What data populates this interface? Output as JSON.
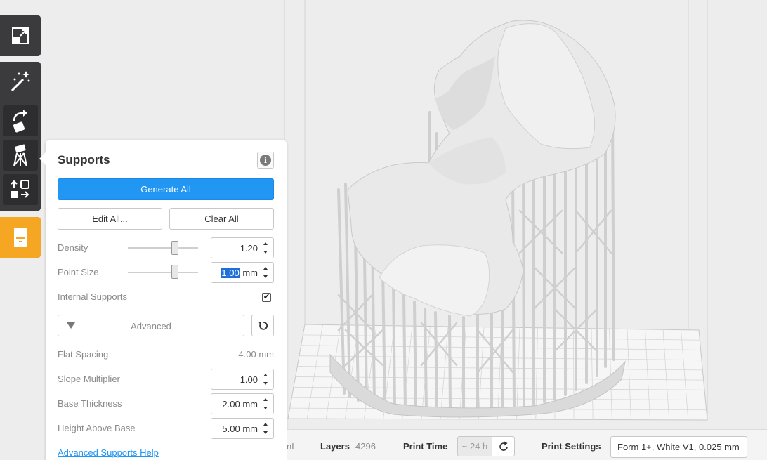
{
  "toolbar": {
    "tools": [
      {
        "icon": "expand-icon"
      },
      {
        "icon": "magic-wand-icon"
      },
      {
        "icon": "rotate-icon"
      },
      {
        "icon": "supports-icon"
      },
      {
        "icon": "layout-icon"
      },
      {
        "icon": "printer-icon"
      }
    ],
    "accent_color": "#f5a623"
  },
  "supports_panel": {
    "title": "Supports",
    "info_icon": "i",
    "generate_all_label": "Generate All",
    "edit_all_label": "Edit All...",
    "clear_all_label": "Clear All",
    "density": {
      "label": "Density",
      "value": "1.20",
      "slider_fraction": 0.67
    },
    "point_size": {
      "label": "Point Size",
      "value": "1.00",
      "unit": "mm",
      "slider_fraction": 0.67
    },
    "internal_supports": {
      "label": "Internal Supports",
      "checked": true,
      "check_glyph": "✔"
    },
    "advanced_label": "Advanced",
    "flat_spacing": {
      "label": "Flat Spacing",
      "value": "4.00 mm"
    },
    "slope_multiplier": {
      "label": "Slope Multiplier",
      "value": "1.00"
    },
    "base_thickness": {
      "label": "Base Thickness",
      "value": "2.00 mm"
    },
    "height_above_base": {
      "label": "Height Above Base",
      "value": "5.00 mm"
    },
    "help_link": "Advanced Supports Help",
    "primary_color": "#2196f3"
  },
  "status_bar": {
    "volume_fragment": "nL",
    "layers_label": "Layers",
    "layers_value": "4296",
    "print_time_label": "Print Time",
    "print_time_value": "~ 24 h",
    "print_settings_label": "Print Settings",
    "print_settings_value": "Form 1+, White V1, 0.025 mm"
  }
}
